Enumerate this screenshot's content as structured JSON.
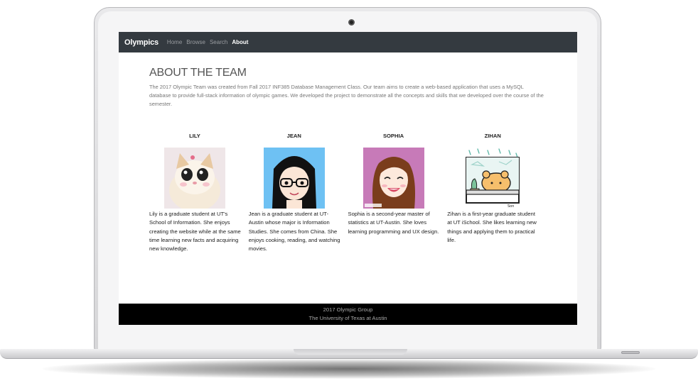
{
  "navbar": {
    "brand": "Olympics",
    "links": [
      "Home",
      "Browse",
      "Search",
      "About"
    ],
    "active": "About"
  },
  "page": {
    "title": "ABOUT THE TEAM",
    "intro": "The 2017 Olympic Team was created from Fall 2017 INF385 Database Management Class. Our team aims to create a web-based application that uses a MySQL database to provide full-stack information of olympic games. We developed the project to demonstrate all the concepts and skills that we developed over the course of the semester."
  },
  "team": [
    {
      "name": "LILY",
      "avatar": "kitten-photo",
      "bio": "Lily is a graduate student at UT's School of Information. She enjoys creating the website while at the same time learning new facts and acquiring new knowledge."
    },
    {
      "name": "JEAN",
      "avatar": "cartoon-girl-glasses",
      "bio": "Jean is a graduate student at UT-Austin whose major is Information Studies. She comes from China. She enjoys cooking, reading, and watching movies."
    },
    {
      "name": "SOPHIA",
      "avatar": "cartoon-girl-smiling",
      "bio": "Sophia is a second-year master of statistics at UT-Austin. She loves learning programming and UX design."
    },
    {
      "name": "ZIHAN",
      "avatar": "cartoon-bear-window",
      "bio": "Zihan is a first-year graduate student at UT iSchool. She likes learning new things and applying them to practical life."
    }
  ],
  "footer": {
    "line1": "2017 Olympic Group",
    "line2": "The University of Texas at Austin"
  },
  "avatar_signature": "Son",
  "colors": {
    "navbar": "#343a40",
    "footer": "#000000",
    "jean_bg": "#6ec1f3",
    "sophia_bg": "#c77ab8"
  }
}
